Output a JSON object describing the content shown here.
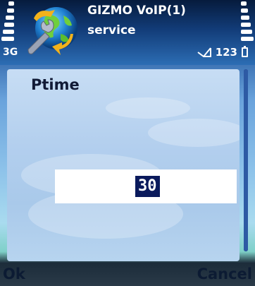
{
  "status_bar": {
    "network": "3G",
    "title": "GIZMO VoIP(1)",
    "subtitle": "service",
    "message_count": "123"
  },
  "dialog": {
    "title": "Ptime",
    "field_value": "30"
  },
  "softkeys": {
    "left": "Ok",
    "right": "Cancel"
  },
  "colors": {
    "accent": "#0a1a5c",
    "text_dark": "#0c1b33",
    "header_bg": "#123c78"
  }
}
